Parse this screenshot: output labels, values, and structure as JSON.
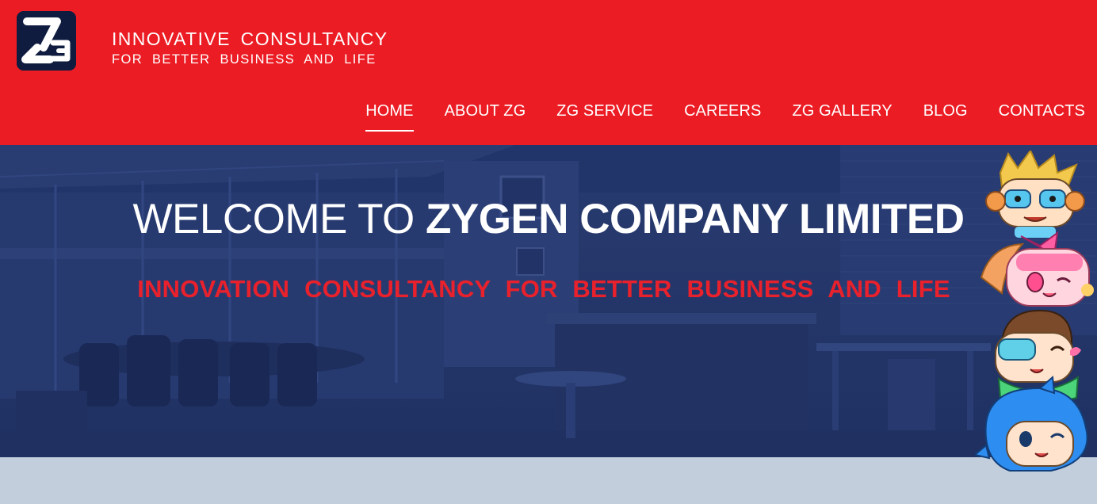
{
  "header": {
    "tagline_main": "INNOVATIVE CONSULTANCY",
    "tagline_sub": "FOR BETTER BUSINESS AND LIFE",
    "nav": [
      {
        "label": "HOME",
        "active": true
      },
      {
        "label": "ABOUT ZG",
        "active": false
      },
      {
        "label": "ZG SERVICE",
        "active": false
      },
      {
        "label": "CAREERS",
        "active": false
      },
      {
        "label": "ZG GALLERY",
        "active": false
      },
      {
        "label": "BLOG",
        "active": false
      },
      {
        "label": "CONTACTS",
        "active": false
      }
    ]
  },
  "hero": {
    "welcome_light": "WELCOME TO ",
    "welcome_bold": "ZYGEN COMPANY LIMITED",
    "subtitle": "INNOVATION CONSULTANCY FOR BETTER BUSINESS AND LIFE"
  },
  "colors": {
    "brand_red": "#ec1c24",
    "logo_navy": "#0f1c3f",
    "hero_overlay": "#27396a",
    "subtitle_red": "#e8212c",
    "footer_band": "#c3cedd"
  },
  "icons": {
    "logo": "zg-logo-icon",
    "mascots": "mascot-characters"
  }
}
